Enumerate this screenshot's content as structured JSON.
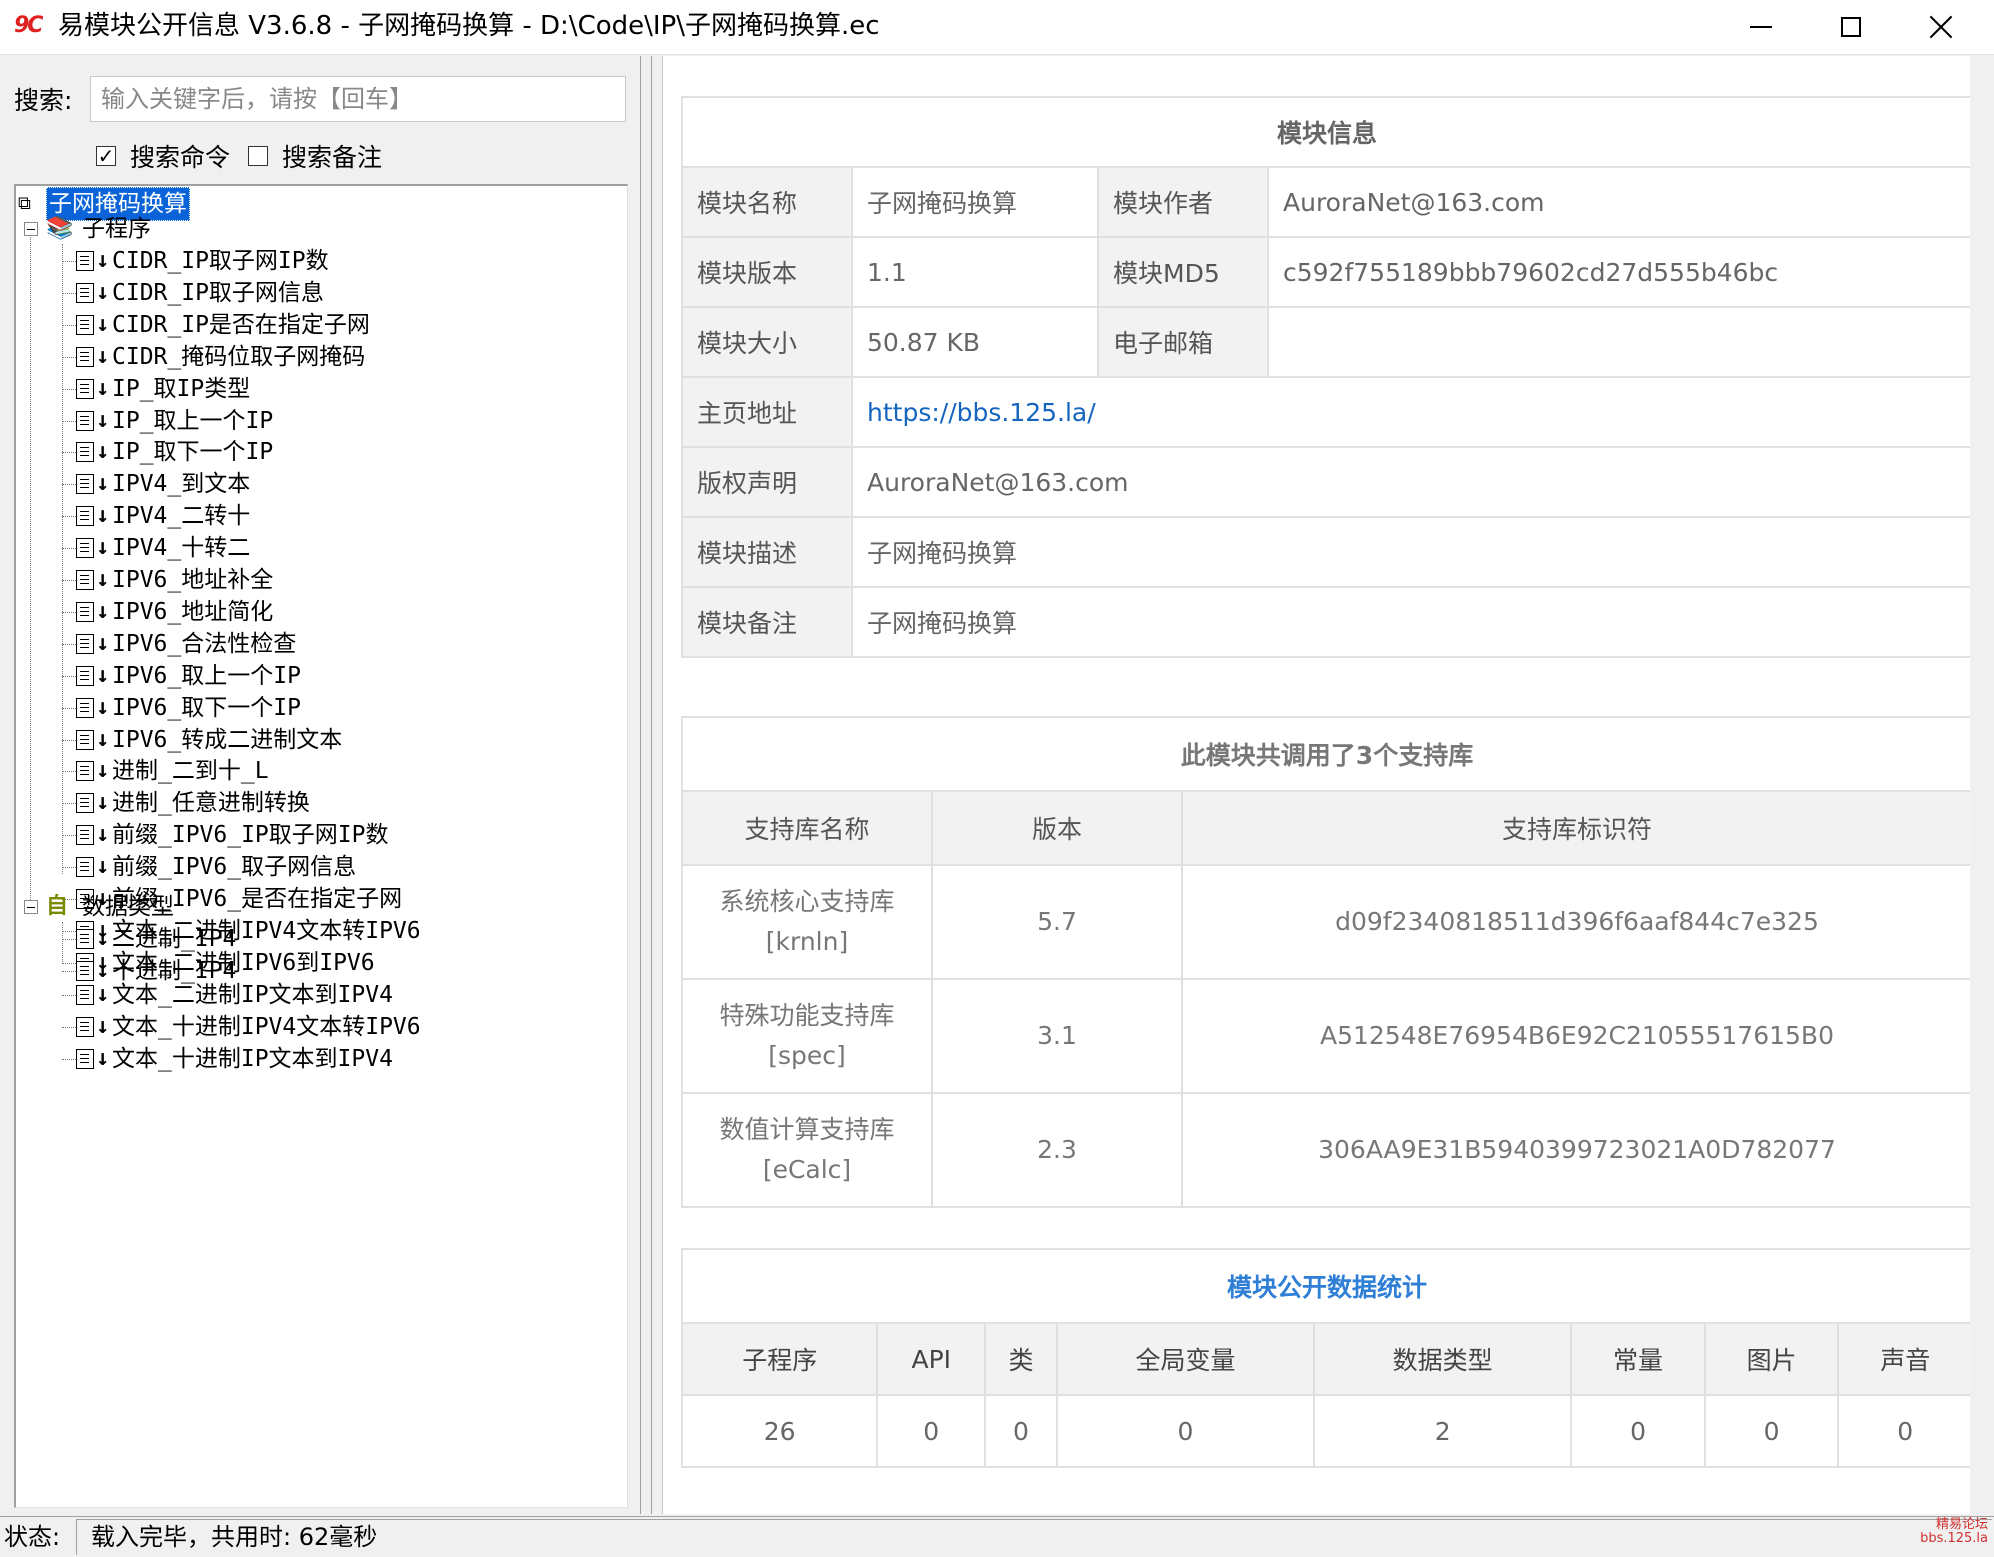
{
  "window": {
    "title": "易模块公开信息 V3.6.8 - 子网掩码换算 - D:\\Code\\IP\\子网掩码换算.ec",
    "app_icon_text": "9C"
  },
  "search": {
    "label": "搜索:",
    "placeholder": "输入关键字后，请按【回车】",
    "option_commands": "搜索命令",
    "option_commands_checked": true,
    "option_notes": "搜索备注",
    "option_notes_checked": false
  },
  "tree": {
    "root": "子网掩码换算",
    "subprograms_label": "子程序",
    "subprograms": [
      "CIDR_IP取子网IP数",
      "CIDR_IP取子网信息",
      "CIDR_IP是否在指定子网",
      "CIDR_掩码位取子网掩码",
      "IP_取IP类型",
      "IP_取上一个IP",
      "IP_取下一个IP",
      "IPV4_到文本",
      "IPV4_二转十",
      "IPV4_十转二",
      "IPV6_地址补全",
      "IPV6_地址简化",
      "IPV6_合法性检查",
      "IPV6_取上一个IP",
      "IPV6_取下一个IP",
      "IPV6_转成二进制文本",
      "进制_二到十_L",
      "进制_任意进制转换",
      "前缀_IPV6_IP取子网IP数",
      "前缀_IPV6_取子网信息",
      "前缀_IPV6_是否在指定子网",
      "文本_二进制IPV4文本转IPV6",
      "文本_二进制IPV6到IPV6",
      "文本_二进制IP文本到IPV4",
      "文本_十进制IPV4文本转IPV6",
      "文本_十进制IP文本到IPV4"
    ],
    "datatypes_label": "数据类型",
    "datatypes": [
      "二进制_IP4",
      "十进制_IP4"
    ]
  },
  "module_info": {
    "title": "模块信息",
    "name_label": "模块名称",
    "name": "子网掩码换算",
    "author_label": "模块作者",
    "author": "AuroraNet@163.com",
    "version_label": "模块版本",
    "version": "1.1",
    "md5_label": "模块MD5",
    "md5": "c592f755189bbb79602cd27d555b46bc",
    "size_label": "模块大小",
    "size": "50.87 KB",
    "email_label": "电子邮箱",
    "email": "",
    "homepage_label": "主页地址",
    "homepage": "https://bbs.125.la/",
    "copyright_label": "版权声明",
    "copyright": "AuroraNet@163.com",
    "desc_label": "模块描述",
    "desc": "子网掩码换算",
    "note_label": "模块备注",
    "note": "子网掩码换算"
  },
  "libraries": {
    "title": "此模块共调用了3个支持库",
    "headers": [
      "支持库名称",
      "版本",
      "支持库标识符"
    ],
    "rows": [
      {
        "name": "系统核心支持库",
        "code": "[krnln]",
        "version": "5.7",
        "id": "d09f2340818511d396f6aaf844c7e325"
      },
      {
        "name": "特殊功能支持库",
        "code": "[spec]",
        "version": "3.1",
        "id": "A512548E76954B6E92C21055517615B0"
      },
      {
        "name": "数值计算支持库",
        "code": "[eCalc]",
        "version": "2.3",
        "id": "306AA9E31B5940399723021A0D782077"
      }
    ]
  },
  "stats": {
    "title": "模块公开数据统计",
    "headers": [
      "子程序",
      "API",
      "类",
      "全局变量",
      "数据类型",
      "常量",
      "图片",
      "声音"
    ],
    "values": [
      "26",
      "0",
      "0",
      "0",
      "2",
      "0",
      "0",
      "0"
    ]
  },
  "status": {
    "label": "状态:",
    "text": "载入完毕，共用时: 62毫秒"
  },
  "watermark": {
    "line1": "精易论坛",
    "line2": "bbs.125.la"
  },
  "colors": {
    "accent_title": "#2f7fd6",
    "link": "#1565c0",
    "selection": "#0a64d8",
    "app_icon": "#e02020"
  }
}
